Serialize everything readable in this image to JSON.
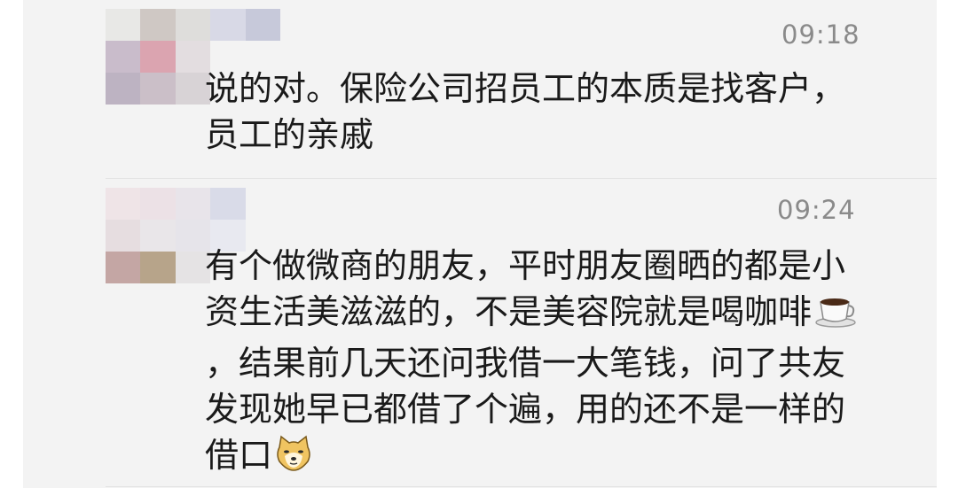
{
  "comments": [
    {
      "time": "09:18",
      "text": "说的对。保险公司招员工的本质是找客户，员工的亲戚",
      "avatar": {
        "pixels": [
          "#e8e8e6",
          "#cfc8c4",
          "#dedddb",
          "#d8d9e6",
          "#c7c9da",
          "#c9bccb",
          "#dba4b0",
          "#e3dde0",
          "#f3f3f3",
          "#f3f3f3",
          "#bdb3c2",
          "#cbbfc8",
          "#d8d3d6",
          "#f3f3f3",
          "#f3f3f3"
        ]
      }
    },
    {
      "time": "09:24",
      "text_parts": [
        "有个做微商的朋友，平时朋友圈晒的都是小资生活美滋滋的，不是美容院就是喝咖啡",
        "，结果前几天还问我借一大笔钱，问了共友发现她早已都借了个遍，用的还不是一样的借口"
      ],
      "emojis": [
        "coffee-cup-icon",
        "doge-face-icon"
      ],
      "avatar": {
        "pixels": [
          "#efe4e7",
          "#ece1e6",
          "#e8e4ea",
          "#d9dbe8",
          "#f3f3f3",
          "#e6dde0",
          "#e9e6e9",
          "#e6e4ea",
          "#e8e9f0",
          "#f3f3f3",
          "#c4a6a4",
          "#b7a48a",
          "#e5e3e4",
          "#f3f3f3",
          "#f3f3f3"
        ]
      }
    }
  ]
}
